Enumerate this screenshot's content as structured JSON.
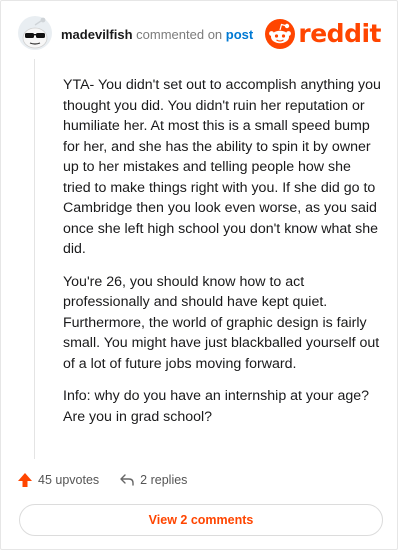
{
  "comment": {
    "username": "madevilfish",
    "action_text": "commented on",
    "target_link": "post",
    "paragraphs": [
      "YTA- You didn't set out to accomplish anything you thought you did. You didn't ruin her reputation or humiliate her. At most this is a small speed bump for her, and she has the ability to spin it by owner up to her mistakes and telling people how she tried to make things right with you. If she did go to Cambridge then you look even worse, as you said once she left high school you don't know what she did.",
      "You're 26, you should know how to act professionally and should have kept quiet. Furthermore, the world of graphic design is fairly small. You might have just blackballed yourself out of a lot of future jobs moving forward.",
      "Info: why do you have an internship at your age? Are you in grad school?"
    ],
    "upvotes_label": "45 upvotes",
    "replies_label": "2 replies",
    "view_comments_label": "View 2 comments"
  },
  "brand": {
    "wordmark": "reddit",
    "accent_color": "#ff4500",
    "link_color": "#0079d3"
  },
  "icons": {
    "avatar": "snoo-sunglasses-avatar",
    "logo": "reddit-snoo-icon",
    "upvote": "upvote-arrow-icon",
    "reply": "reply-arrow-icon"
  }
}
